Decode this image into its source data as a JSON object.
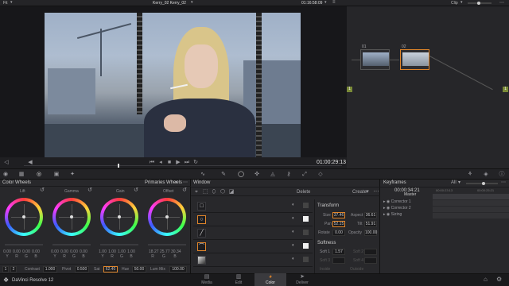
{
  "topbar": {
    "fit": "Fit",
    "clip_name": "Kerry_02 Kerry_02",
    "timecode": "01:16:58:09",
    "clip_menu": "Clip"
  },
  "viewer": {
    "timecode": "01:00:29:13"
  },
  "nodes": [
    {
      "id": "01"
    },
    {
      "id": "02"
    }
  ],
  "color_wheels": {
    "title": "Color Wheels",
    "mode": "Primaries Wheels",
    "wheels": [
      {
        "name": "Lift",
        "values": [
          "0.00",
          "0.00",
          "0.00",
          "0.00"
        ]
      },
      {
        "name": "Gamma",
        "values": [
          "0.00",
          "0.00",
          "0.00",
          "0.00"
        ]
      },
      {
        "name": "Gain",
        "values": [
          "1.00",
          "1.00",
          "1.00",
          "1.00"
        ]
      },
      {
        "name": "Offset",
        "values": [
          "18.27",
          "25.77",
          "30.34",
          ""
        ]
      }
    ],
    "channels": [
      "Y",
      "R",
      "G",
      "B"
    ],
    "bottom": {
      "first": "1",
      "first2": "2",
      "contrast_label": "Contrast",
      "contrast": "1.000",
      "pivot_label": "Pivot",
      "pivot": "0.500",
      "sat_label": "Sat",
      "sat": "62.40",
      "hue_label": "Hue",
      "hue": "50.00",
      "lummix_label": "Lum Mix",
      "lummix": "100.00"
    }
  },
  "window_panel": {
    "title": "Window",
    "delete_label": "Delete",
    "create_label": "Create",
    "transform": {
      "title": "Transform",
      "size_label": "Size",
      "size": "37.46",
      "aspect_label": "Aspect",
      "aspect": "36.61",
      "pan_label": "Pan",
      "pan": "52.15",
      "tilt_label": "Tilt",
      "tilt": "51.91",
      "rotate_label": "Rotate",
      "rotate": "0.00",
      "opacity_label": "Opacity",
      "opacity": "100.00"
    },
    "softness": {
      "title": "Softness",
      "soft1_label": "Soft 1",
      "soft1": "1.57",
      "soft2_label": "Soft 2",
      "soft2": "",
      "soft3_label": "Soft 3",
      "soft3": "",
      "soft4_label": "Soft 4",
      "soft4": "",
      "inside_label": "Inside",
      "outside_label": "Outside"
    }
  },
  "keyframes": {
    "title": "Keyframes",
    "filter": "All",
    "timecode": "00:00:34:21",
    "ruler": [
      "00:00:23:13",
      "00:00:25:21"
    ],
    "tracks": [
      "Master",
      "Corrector 1",
      "Corrector 2",
      "Sizing"
    ]
  },
  "footer": {
    "app_name": "DaVinci Resolve 12",
    "tabs": [
      "Media",
      "Edit",
      "Color",
      "Deliver"
    ],
    "active_tab": "Color"
  },
  "colors": {
    "accent": "#e0852a",
    "active_tab_bg": "#3a3a3e"
  }
}
